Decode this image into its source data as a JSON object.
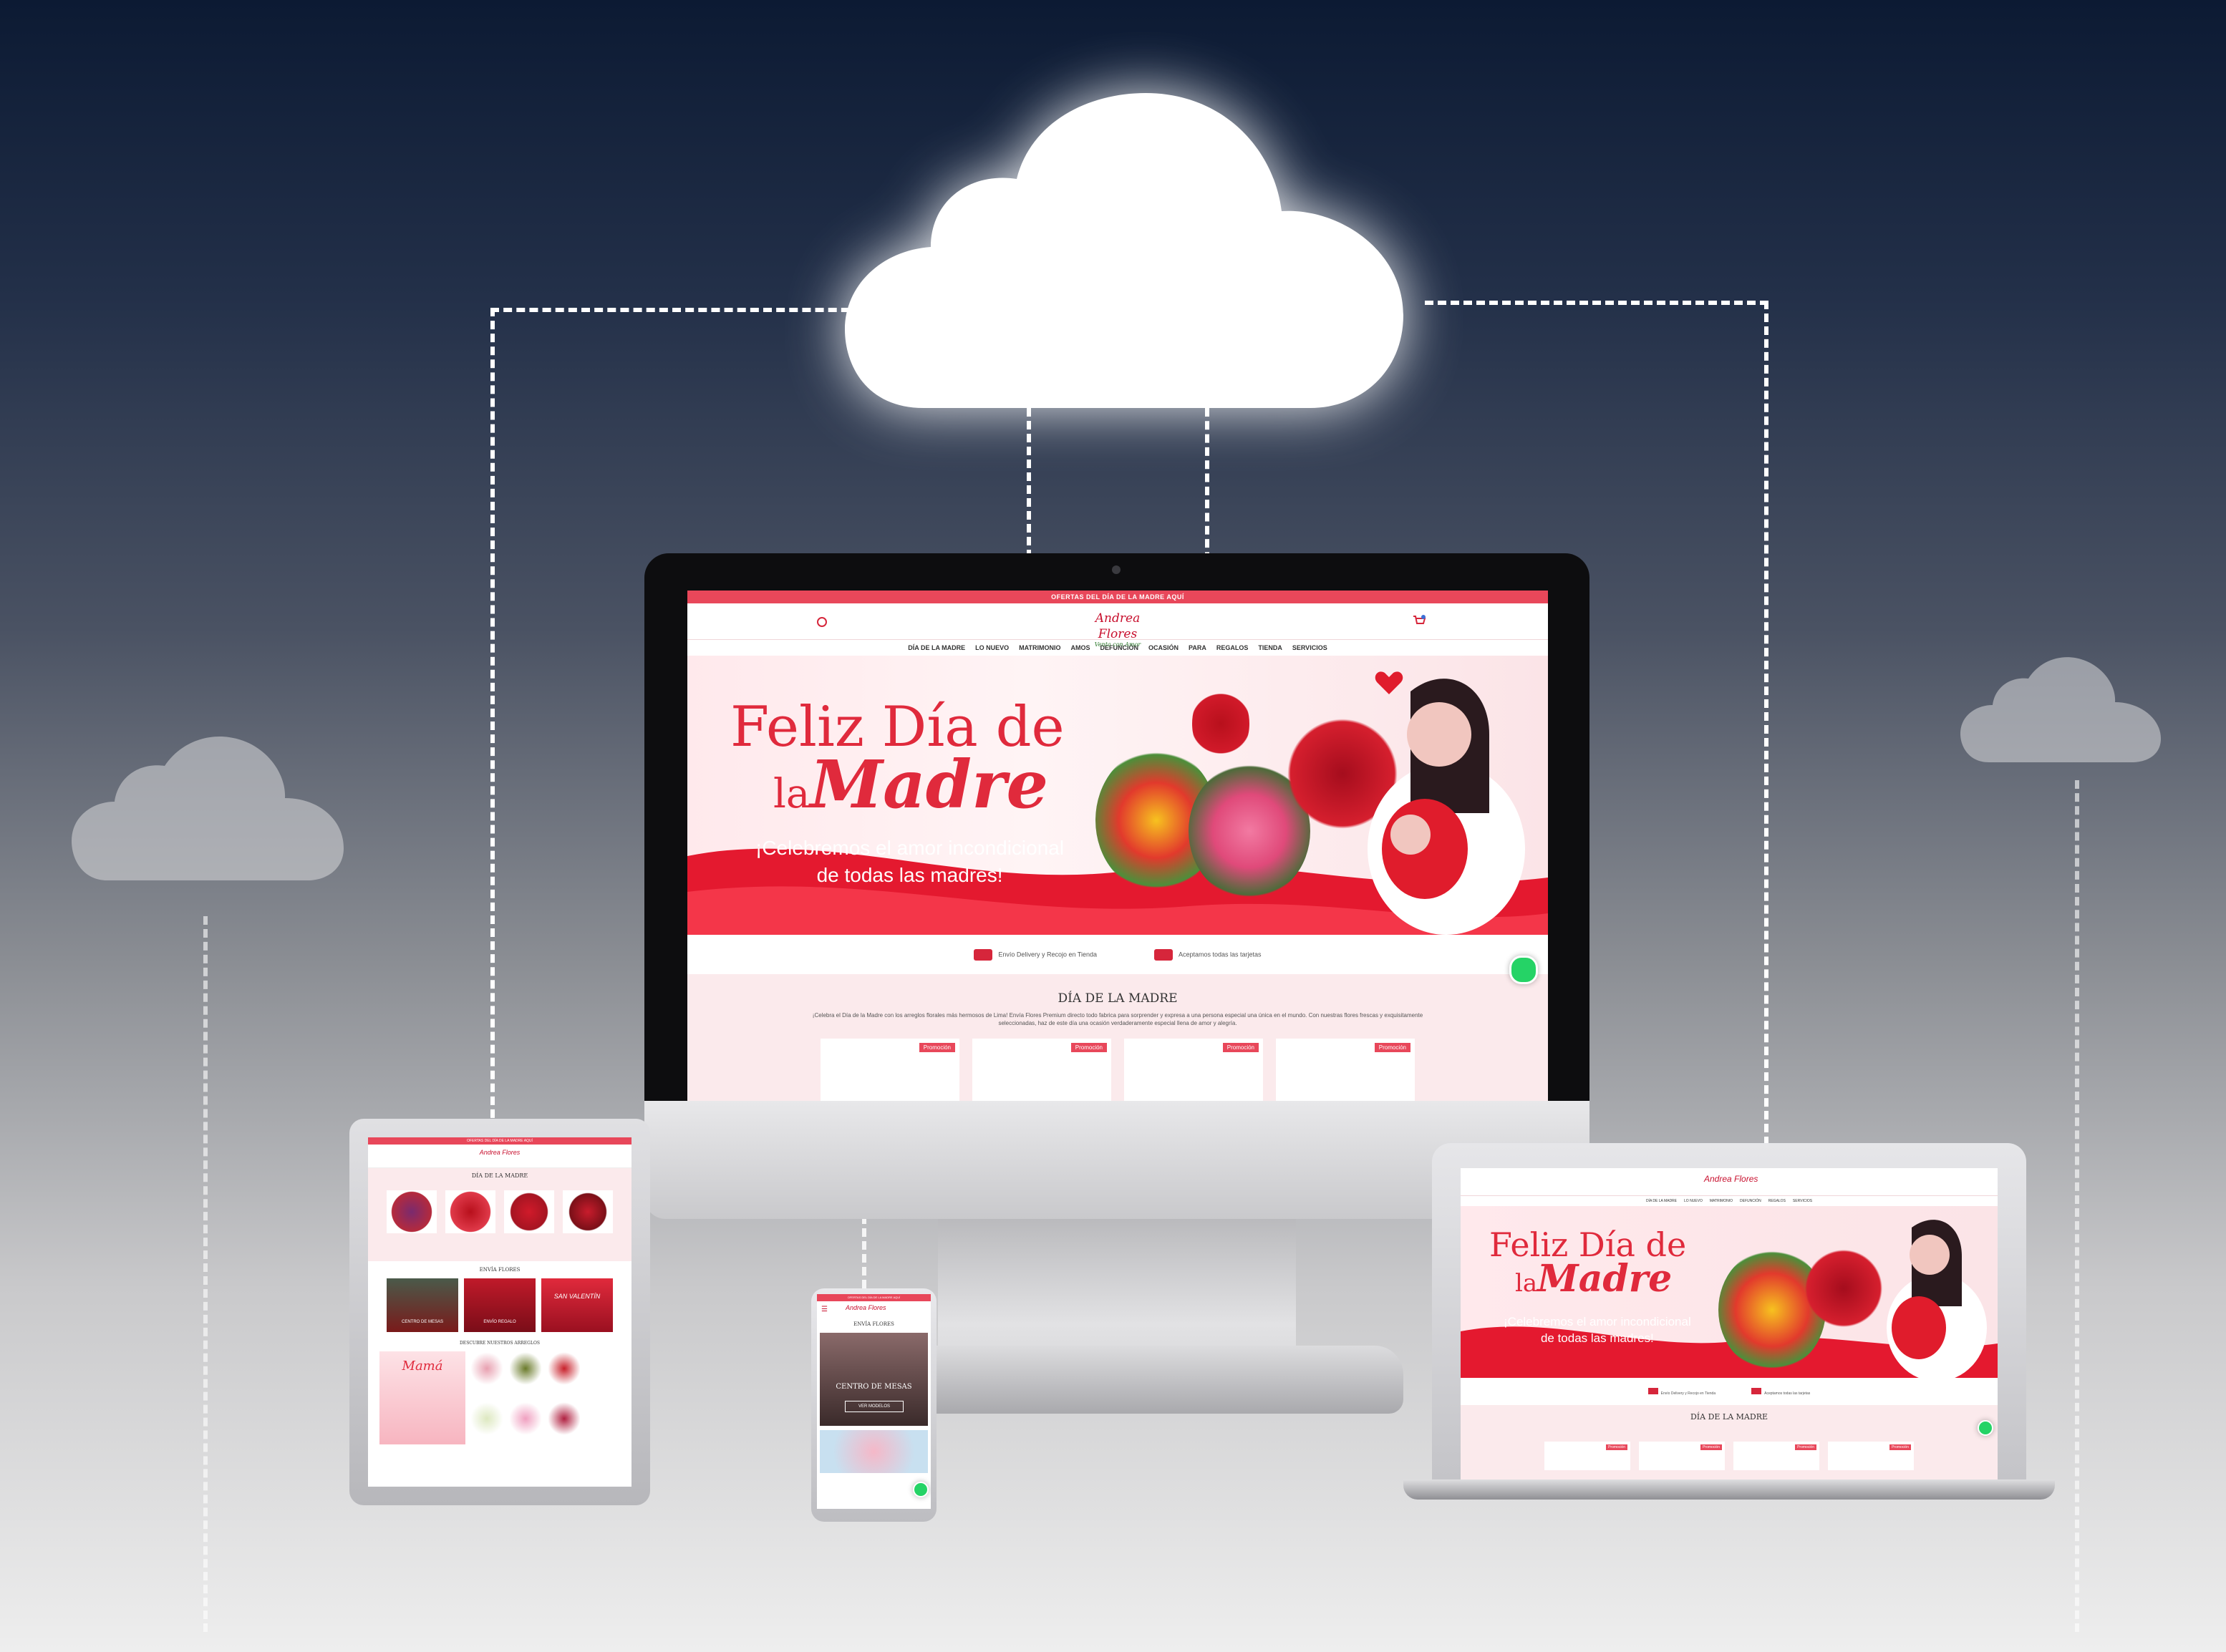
{
  "monitor": {
    "topbar": "OFERTAS DEL DÍA DE LA MADRE AQUÍ",
    "logo": "Andrea Flores",
    "logo_tagline": "Venta con Amor",
    "nav": [
      "DÍA DE LA MADRE",
      "LO NUEVO",
      "MATRIMONIO",
      "AMOS",
      "DEFUNCIÓN",
      "OCASIÓN",
      "PARA",
      "REGALOS",
      "TIENDA",
      "SERVICIOS"
    ],
    "hero_title_1": "Feliz Día de",
    "hero_title_la": "la",
    "hero_title_2": "Madre",
    "hero_sub_1": "¡Celebremos el amor incondicional",
    "hero_sub_2": "de todas las madres!",
    "strip": [
      "Envío Delivery y Recojo en Tienda",
      "Aceptamos todas las tarjetas"
    ],
    "section_title": "DÍA DE LA MADRE",
    "section_desc": "¡Celebra el Día de la Madre con los arreglos florales más hermosos de Lima! Envía Flores Premium directo todo fabrica para sorprender y expresa a una persona especial una única en el mundo. Con nuestras flores frescas y exquisitamente seleccionadas, haz de este día una ocasión verdaderamente especial llena de amor y alegría.",
    "card_badge": "Promoción"
  },
  "tablet": {
    "topbar": "OFERTAS DEL DÍA DE LA MADRE AQUÍ",
    "section_title": "DÍA DE LA MADRE",
    "section2": "ENVÍA FLORES",
    "card_labels": [
      "CENTRO DE MESAS",
      "ENVÍO REGALO",
      "SAN VALENTÍN"
    ],
    "promo_script": "Mamá",
    "section3": "DESCUBRE NUESTROS ARREGLOS"
  },
  "phone": {
    "topbar": "OFERTAS DEL DÍA DE LA MADRE AQUÍ",
    "section": "ENVÍA FLORES",
    "banner_title": "CENTRO DE MESAS",
    "banner_btn": "VER MODELOS"
  },
  "laptop": {
    "hero_title_1": "Feliz Día de",
    "hero_title_la": "la",
    "hero_title_2": "Madre",
    "hero_sub_1": "¡Celebremos el amor incondicional",
    "hero_sub_2": "de todas las madres!",
    "section_title": "DÍA DE LA MADRE",
    "card_badge": "Promoción"
  },
  "colors": {
    "brand_red": "#e02a3c",
    "accent_pink": "#e8475a",
    "whatsapp": "#25d366"
  }
}
